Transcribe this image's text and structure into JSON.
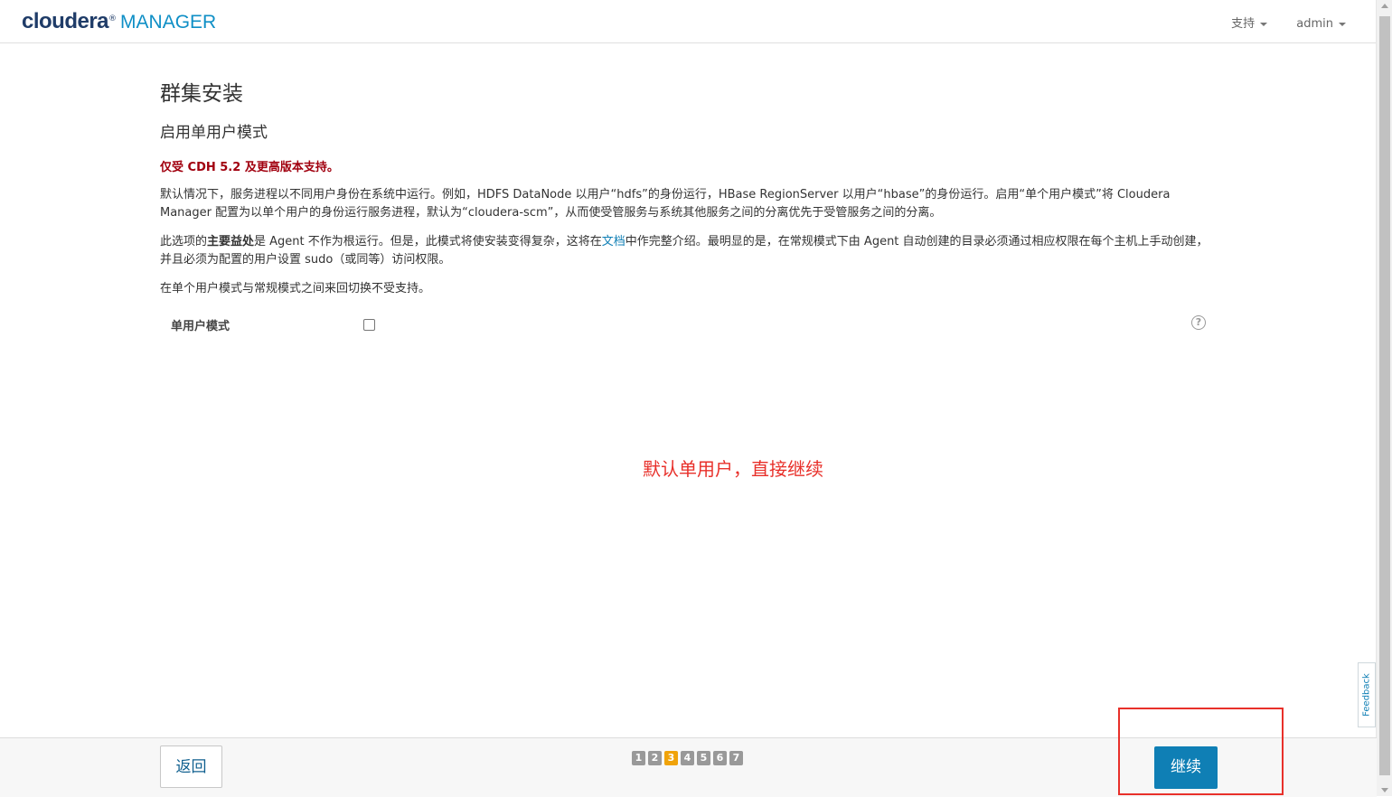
{
  "header": {
    "brand": "cloudera",
    "brand_mark": "®",
    "product": "MANAGER",
    "support_menu": "支持",
    "user_menu": "admin"
  },
  "page": {
    "title": "群集安装",
    "subtitle": "启用单用户模式",
    "warning": "仅受 CDH 5.2 及更高版本支持。",
    "paragraph1": "默认情况下，服务进程以不同用户身份在系统中运行。例如，HDFS DataNode 以用户“hdfs”的身份运行，HBase RegionServer 以用户“hbase”的身份运行。启用“单个用户模式”将 Cloudera Manager 配置为以单个用户的身份运行服务进程，默认为“cloudera-scm”，从而使受管服务与系统其他服务之间的分离优先于受管服务之间的分离。",
    "paragraph2_a": "此选项的",
    "paragraph2_bold": "主要益处",
    "paragraph2_b": "是 Agent 不作为根运行。但是，此模式将使安装变得复杂，这将在",
    "paragraph2_link": "文档",
    "paragraph2_c": "中作完整介绍。最明显的是，在常规模式下由 Agent 自动创建的目录必须通过相应权限在每个主机上手动创建，并且必须为配置的用户设置 sudo（或同等）访问权限。",
    "paragraph3": "在单个用户模式与常规模式之间来回切换不受支持。",
    "field_label": "单用户模式",
    "single_user_checked": false,
    "help_icon": "?"
  },
  "annotation": "默认单用户，直接继续",
  "feedback": "Feedback",
  "footer": {
    "back": "返回",
    "continue": "继续",
    "steps": [
      "1",
      "2",
      "3",
      "4",
      "5",
      "6",
      "7"
    ],
    "current_step": "3"
  },
  "colors": {
    "brand_dark": "#1f3c68",
    "brand_light": "#0f8fc6",
    "warning": "#a1000f",
    "primary_button": "#0f7fb5",
    "active_step": "#f0a30a",
    "annotation": "#e8302a"
  }
}
